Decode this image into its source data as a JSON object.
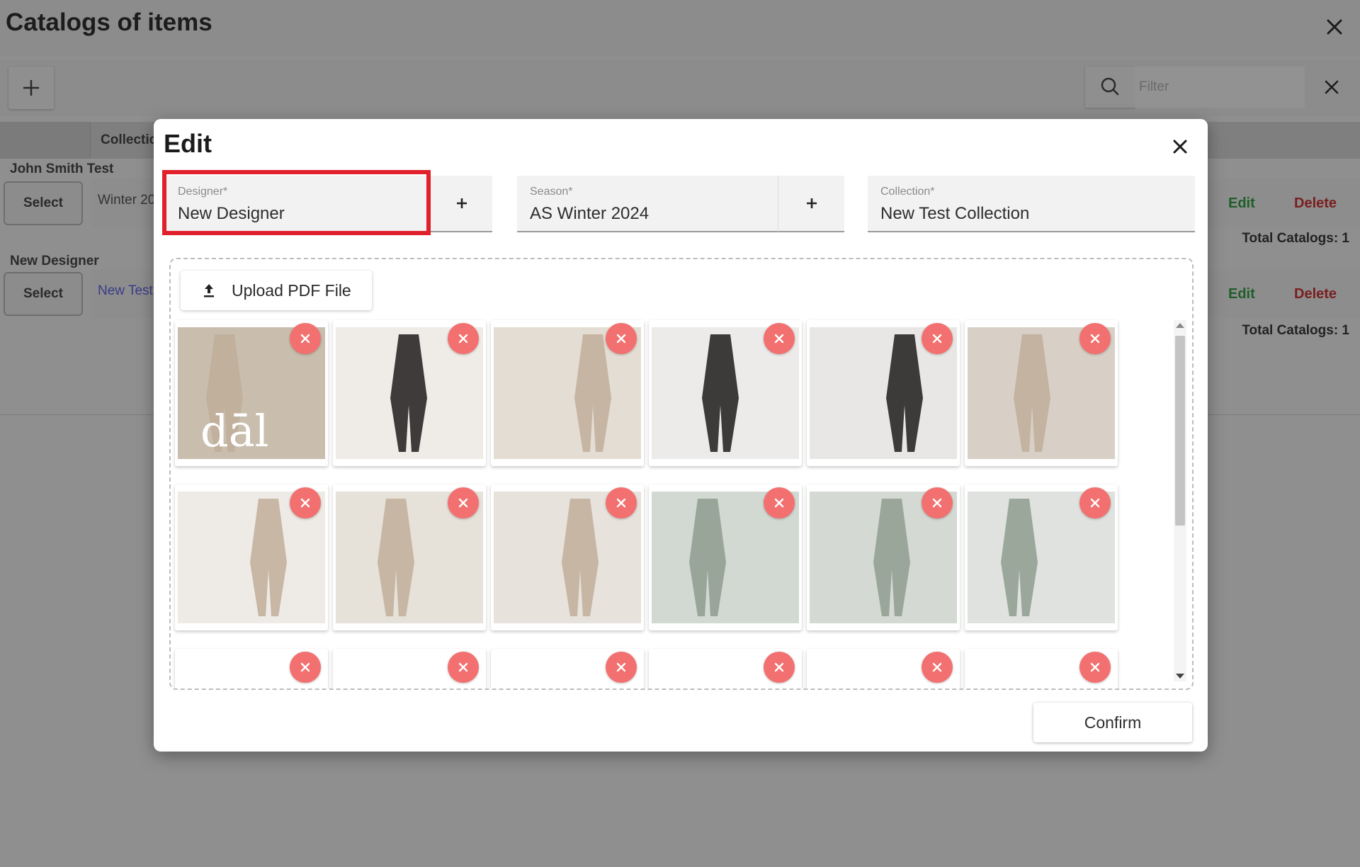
{
  "page": {
    "title": "Catalogs of items",
    "filter_placeholder": "Filter",
    "table": {
      "collection_header": "Collectic"
    },
    "groups": [
      {
        "name": "John Smith Test",
        "select_label": "Select",
        "cell": "Winter 20",
        "edit_label": "Edit",
        "delete_label": "Delete",
        "total": "Total Catalogs: 1"
      },
      {
        "name": "New Designer",
        "select_label": "Select",
        "cell": "New Test",
        "edit_label": "Edit",
        "delete_label": "Delete",
        "total": "Total Catalogs: 1"
      }
    ]
  },
  "modal": {
    "title": "Edit",
    "fields": {
      "designer": {
        "label": "Designer*",
        "value": "New Designer"
      },
      "season": {
        "label": "Season*",
        "value": "AS Winter 2024"
      },
      "collection": {
        "label": "Collection*",
        "value": "New Test Collection"
      }
    },
    "upload_label": "Upload PDF File",
    "confirm_label": "Confirm",
    "thumbnails": [
      {
        "name": "catalog-page-1",
        "caption": "dāl",
        "tone": "#c9beae"
      },
      {
        "name": "catalog-page-2",
        "tone": "#efece7"
      },
      {
        "name": "catalog-page-3",
        "tone": "#e4ddd3"
      },
      {
        "name": "catalog-page-4",
        "tone": "#ecebea"
      },
      {
        "name": "catalog-page-5",
        "tone": "#e9e7e5"
      },
      {
        "name": "catalog-page-6",
        "tone": "#d8d0c6"
      },
      {
        "name": "catalog-page-7",
        "tone": "#eeeae5"
      },
      {
        "name": "catalog-page-8",
        "tone": "#e6e1d9"
      },
      {
        "name": "catalog-page-9",
        "tone": "#e7e2db"
      },
      {
        "name": "catalog-page-10",
        "tone": "#d2d8d2"
      },
      {
        "name": "catalog-page-11",
        "tone": "#d4d9d3"
      },
      {
        "name": "catalog-page-12",
        "tone": "#dfe2df"
      },
      {
        "name": "catalog-page-13",
        "tone": "#ffffff"
      },
      {
        "name": "catalog-page-14",
        "tone": "#ffffff"
      },
      {
        "name": "catalog-page-15",
        "tone": "#ffffff"
      },
      {
        "name": "catalog-page-16",
        "tone": "#ffffff"
      },
      {
        "name": "catalog-page-17",
        "tone": "#ffffff"
      },
      {
        "name": "catalog-page-18",
        "tone": "#ffffff"
      }
    ]
  },
  "colors": {
    "highlight": "#e0202b",
    "remove_button": "#f2706f",
    "edit_text": "#1f5e29",
    "delete_text": "#7a1e1e"
  },
  "icons": [
    "close-icon",
    "plus-icon",
    "search-icon",
    "upload-icon",
    "remove-icon",
    "scroll-up-icon",
    "scroll-down-icon"
  ]
}
